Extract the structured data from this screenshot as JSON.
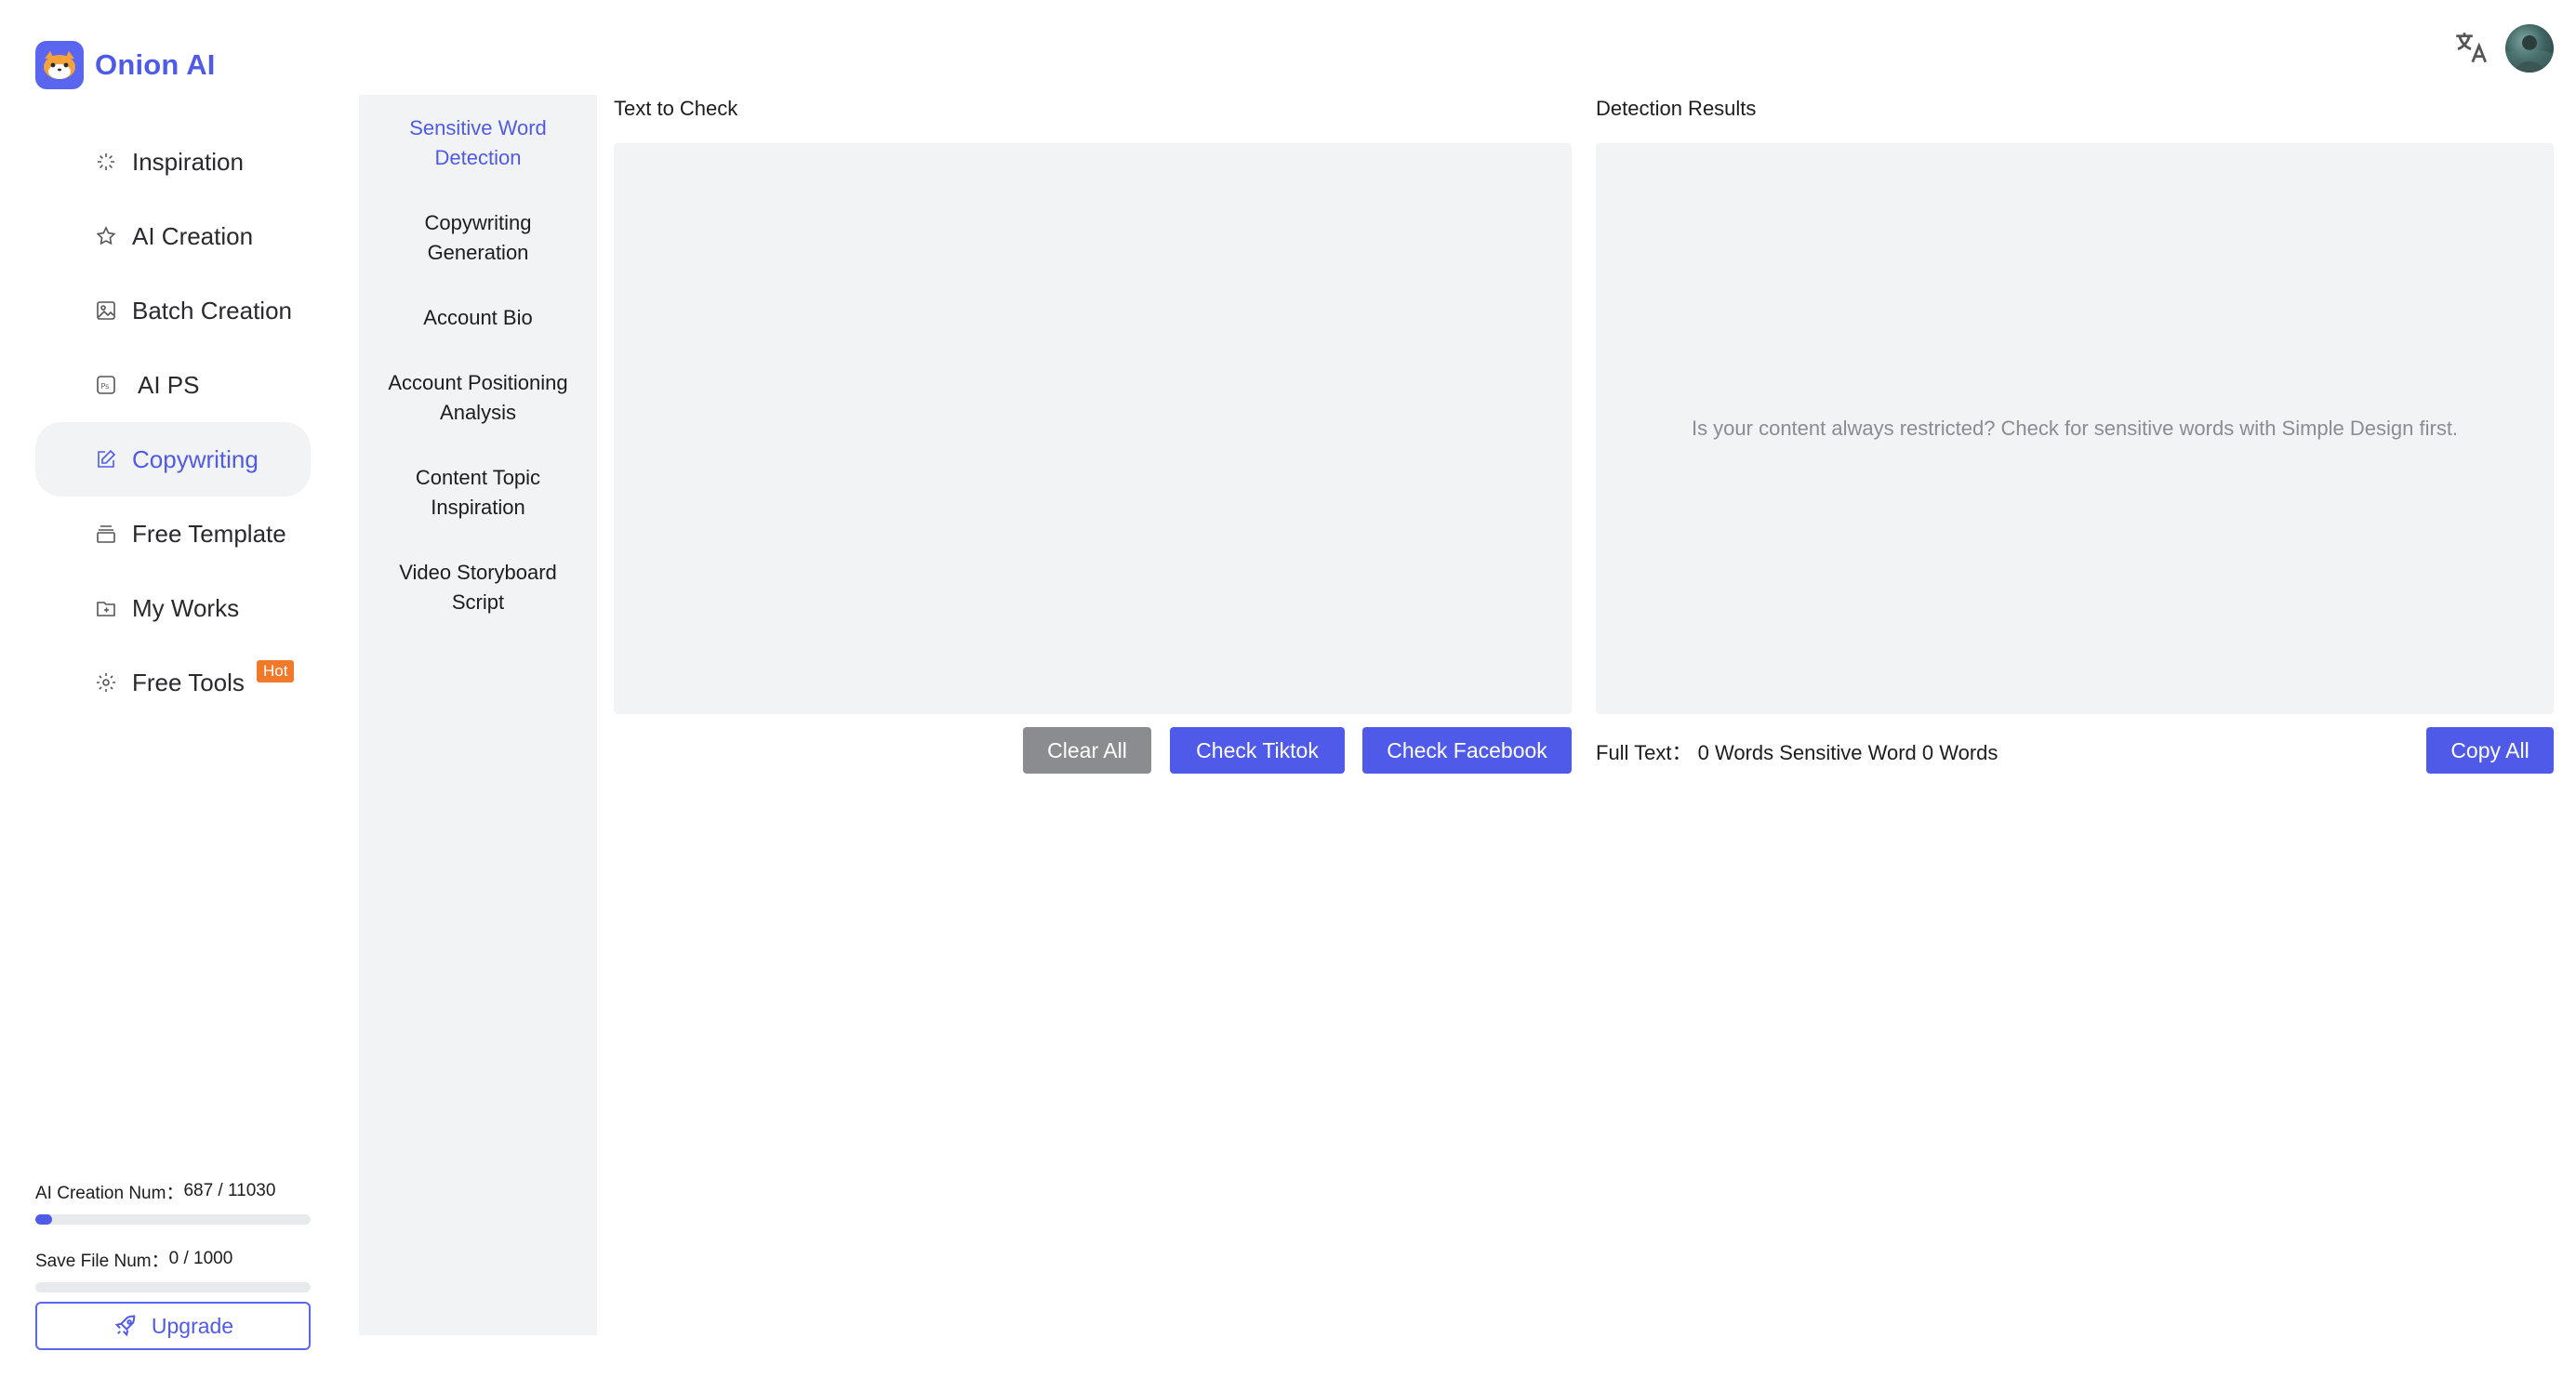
{
  "app": {
    "name": "Onion AI"
  },
  "sidebar": {
    "items": [
      {
        "label": "Inspiration"
      },
      {
        "label": "AI Creation"
      },
      {
        "label": "Batch Creation"
      },
      {
        "label": "AI PS"
      },
      {
        "label": "Copywriting"
      },
      {
        "label": "Free Template"
      },
      {
        "label": "My Works"
      },
      {
        "label": "Free Tools",
        "badge": "Hot"
      }
    ],
    "active_index": 4
  },
  "usage": {
    "ai_creation_label": "AI Creation Num：",
    "ai_creation_value": "687 / 11030",
    "ai_creation_fraction": 0.0623,
    "save_file_label": "Save File Num：",
    "save_file_value": "0 / 1000",
    "save_file_fraction": 0.0,
    "upgrade_label": "Upgrade"
  },
  "submenu": {
    "items": [
      {
        "label": "Sensitive Word Detection"
      },
      {
        "label": "Copywriting Generation"
      },
      {
        "label": "Account Bio"
      },
      {
        "label": "Account Positioning Analysis"
      },
      {
        "label": "Content Topic Inspiration"
      },
      {
        "label": "Video Storyboard Script"
      }
    ],
    "active_index": 0
  },
  "check": {
    "title": "Text to Check",
    "value": "",
    "clear_label": "Clear All",
    "tiktok_label": "Check Tiktok",
    "facebook_label": "Check Facebook"
  },
  "results": {
    "title": "Detection Results",
    "placeholder": "Is your content always restricted? Check for sensitive words with Simple Design first.",
    "stats": "Full Text：  0 Words Sensitive Word 0 Words",
    "copy_label": "Copy All"
  },
  "colors": {
    "accent": "#4f5be8",
    "panel_bg": "#f2f3f5",
    "hot_badge": "#f07a2a",
    "gray_button": "#8b8c90"
  }
}
